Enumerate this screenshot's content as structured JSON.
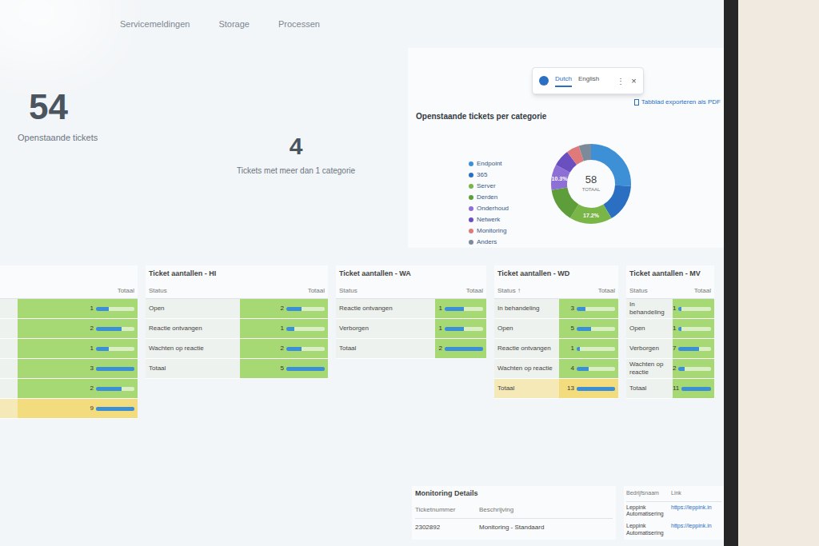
{
  "nav": [
    "Servicemeldingen",
    "Storage",
    "Processen"
  ],
  "kpis": [
    {
      "value": "54",
      "label": "Openstaande tickets"
    },
    {
      "value": "4",
      "label": "Tickets met meer dan 1 categorie"
    }
  ],
  "language_popover": {
    "tabs": [
      {
        "label": "Dutch",
        "selected": true
      },
      {
        "label": "English",
        "selected": false
      }
    ],
    "menu": "⋮",
    "close": "×"
  },
  "export_link": "Tabblad exporteren als PDF",
  "category_chart": {
    "title": "Openstaande tickets per categorie",
    "center_value": "58",
    "center_label": "TOTAAL",
    "series": [
      {
        "name": "Endpoint",
        "value": 15,
        "color": "#3d8fd6"
      },
      {
        "name": "365",
        "value": 9,
        "color": "#2a6fc2"
      },
      {
        "name": "Server",
        "value": 10,
        "color": "#79b547",
        "pct_label": "17.2%"
      },
      {
        "name": "Derden",
        "value": 8,
        "color": "#5e9e3a"
      },
      {
        "name": "Onderhoud",
        "value": 6,
        "color": "#8e6fd6",
        "pct_label": "10.3%"
      },
      {
        "name": "Netwerk",
        "value": 4,
        "color": "#6a4fc0"
      },
      {
        "name": "Monitoring",
        "value": 3,
        "color": "#e07a7a"
      },
      {
        "name": "Anders",
        "value": 3,
        "color": "#7d8a99"
      }
    ]
  },
  "tables": [
    {
      "columns": [
        "Totaal"
      ],
      "rows": [
        {
          "value": "1",
          "level": 0.33,
          "warning": false
        },
        {
          "value": "2",
          "level": 0.67,
          "warning": false
        },
        {
          "value": "1",
          "level": 0.33,
          "warning": false
        },
        {
          "value": "3",
          "level": 1.0,
          "warning": false
        },
        {
          "value": "2",
          "level": 0.67,
          "warning": false
        },
        {
          "value": "9",
          "level": 1.0,
          "warning": true
        }
      ]
    },
    {
      "title": "Ticket aantallen - HI",
      "columns": [
        "Status",
        "Totaal"
      ],
      "rows": [
        {
          "label": "Open",
          "value": "2",
          "level": 0.4,
          "warning": false
        },
        {
          "label": "Reactie ontvangen",
          "value": "1",
          "level": 0.2,
          "warning": false
        },
        {
          "label": "Wachten op reactie",
          "value": "2",
          "level": 0.4,
          "warning": false
        },
        {
          "label": "Totaal",
          "value": "5",
          "level": 1.0,
          "warning": false
        }
      ]
    },
    {
      "title": "Ticket aantallen - WA",
      "columns": [
        "Status",
        "Totaal"
      ],
      "rows": [
        {
          "label": "Reactie ontvangen",
          "value": "1",
          "level": 0.5,
          "warning": false
        },
        {
          "label": "Verborgen",
          "value": "1",
          "level": 0.5,
          "warning": false
        },
        {
          "label": "Totaal",
          "value": "2",
          "level": 1.0,
          "warning": false
        }
      ]
    },
    {
      "title": "Ticket aantallen - WD",
      "columns": [
        "Status ↑",
        "Totaal"
      ],
      "rows": [
        {
          "label": "In behandeling",
          "value": "3",
          "level": 0.23,
          "warning": false
        },
        {
          "label": "Open",
          "value": "5",
          "level": 0.38,
          "warning": false
        },
        {
          "label": "Reactie ontvangen",
          "value": "1",
          "level": 0.08,
          "warning": false
        },
        {
          "label": "Wachten op reactie",
          "value": "4",
          "level": 0.31,
          "warning": false
        },
        {
          "label": "Totaal",
          "value": "13",
          "level": 1.0,
          "warning": true
        }
      ]
    },
    {
      "title": "Ticket aantallen - MV",
      "columns": [
        "Status",
        "Totaal"
      ],
      "rows": [
        {
          "label": "In behandeling",
          "value": "1",
          "level": 0.09,
          "warning": false
        },
        {
          "label": "Open",
          "value": "1",
          "level": 0.09,
          "warning": false
        },
        {
          "label": "Verborgen",
          "value": "7",
          "level": 0.64,
          "warning": false
        },
        {
          "label": "Wachten op reactie",
          "value": "2",
          "level": 0.18,
          "warning": false
        },
        {
          "label": "Totaal",
          "value": "11",
          "level": 1.0,
          "warning": false
        }
      ]
    }
  ],
  "monitoring": {
    "title": "Monitoring Details",
    "columns": [
      "Ticketnummer",
      "Beschrijving"
    ],
    "rows": [
      [
        "2302892",
        "Monitoring - Standaard"
      ]
    ]
  },
  "links": {
    "columns": [
      "Bedrijfsnaam",
      "Link"
    ],
    "rows": [
      [
        "Leppink Automatisering",
        "https://leppink.in"
      ],
      [
        "Leppink Automatisering",
        "https://leppink.in"
      ]
    ]
  }
}
